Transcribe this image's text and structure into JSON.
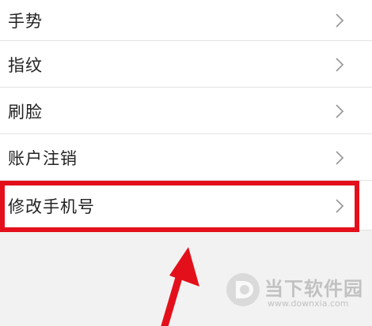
{
  "settings_list": {
    "items": [
      {
        "label": "手势"
      },
      {
        "label": "指纹"
      },
      {
        "label": "刷脸"
      },
      {
        "label": "账户注销"
      },
      {
        "label": "修改手机号"
      }
    ]
  },
  "annotation": {
    "highlight_color": "#e3101b",
    "arrow_color": "#e3101b"
  },
  "watermark": {
    "name": "当下软件园",
    "url": "www.downxia.com"
  },
  "icons": {
    "row_chevron": "chevron-right-icon"
  }
}
